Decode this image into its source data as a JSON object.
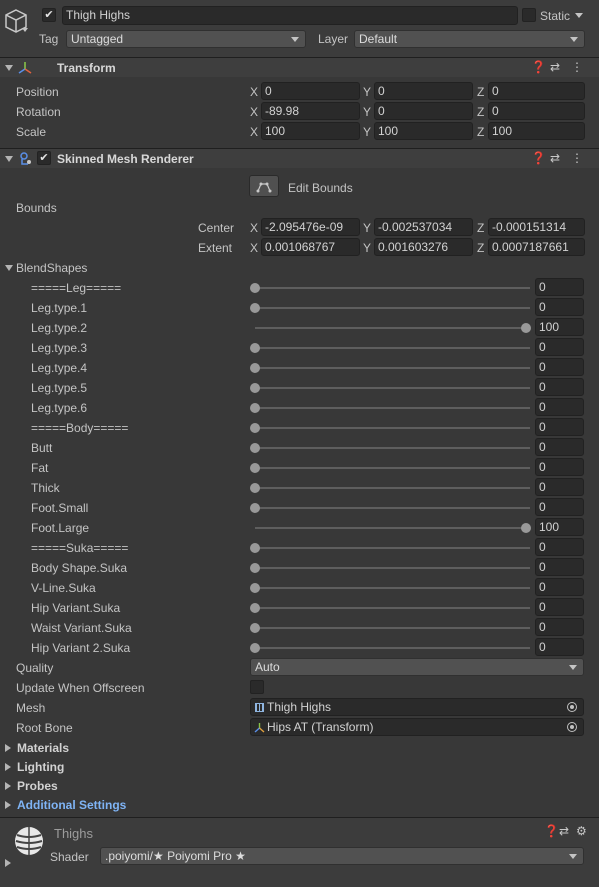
{
  "gameobject": {
    "name": "Thigh Highs",
    "active": true,
    "static_label": "Static",
    "tag_label": "Tag",
    "tag_value": "Untagged",
    "layer_label": "Layer",
    "layer_value": "Default"
  },
  "transform": {
    "title": "Transform",
    "rows": [
      {
        "label": "Position",
        "x": "0",
        "y": "0",
        "z": "0"
      },
      {
        "label": "Rotation",
        "x": "-89.98",
        "y": "0",
        "z": "0"
      },
      {
        "label": "Scale",
        "x": "100",
        "y": "100",
        "z": "100"
      }
    ]
  },
  "axes": {
    "x": "X",
    "y": "Y",
    "z": "Z"
  },
  "smr": {
    "title": "Skinned Mesh Renderer",
    "enabled": true,
    "edit_bounds": "Edit Bounds",
    "bounds_label": "Bounds",
    "center_label": "Center",
    "center": {
      "x": "-2.095476e-09",
      "y": "-0.002537034",
      "z": "-0.000151314"
    },
    "extent_label": "Extent",
    "extent": {
      "x": "0.001068767",
      "y": "0.001603276",
      "z": "0.0007187661"
    },
    "blendshapes_label": "BlendShapes",
    "blendshapes": [
      {
        "name": "=====Leg=====",
        "value": "0",
        "fraction": 0
      },
      {
        "name": "Leg.type.1",
        "value": "0",
        "fraction": 0
      },
      {
        "name": "Leg.type.2",
        "value": "100",
        "fraction": 1
      },
      {
        "name": "Leg.type.3",
        "value": "0",
        "fraction": 0
      },
      {
        "name": "Leg.type.4",
        "value": "0",
        "fraction": 0
      },
      {
        "name": "Leg.type.5",
        "value": "0",
        "fraction": 0
      },
      {
        "name": "Leg.type.6",
        "value": "0",
        "fraction": 0
      },
      {
        "name": "=====Body=====",
        "value": "0",
        "fraction": 0
      },
      {
        "name": "Butt",
        "value": "0",
        "fraction": 0
      },
      {
        "name": "Fat",
        "value": "0",
        "fraction": 0
      },
      {
        "name": "Thick",
        "value": "0",
        "fraction": 0
      },
      {
        "name": "Foot.Small",
        "value": "0",
        "fraction": 0
      },
      {
        "name": "Foot.Large",
        "value": "100",
        "fraction": 1
      },
      {
        "name": "=====Suka=====",
        "value": "0",
        "fraction": 0
      },
      {
        "name": "Body Shape.Suka",
        "value": "0",
        "fraction": 0
      },
      {
        "name": "V-Line.Suka",
        "value": "0",
        "fraction": 0
      },
      {
        "name": "Hip Variant.Suka",
        "value": "0",
        "fraction": 0
      },
      {
        "name": "Waist Variant.Suka",
        "value": "0",
        "fraction": 0
      },
      {
        "name": "Hip Variant 2.Suka",
        "value": "0",
        "fraction": 0
      }
    ],
    "quality_label": "Quality",
    "quality_value": "Auto",
    "offscreen_label": "Update When Offscreen",
    "offscreen_checked": false,
    "mesh_label": "Mesh",
    "mesh_value": "Thigh Highs",
    "rootbone_label": "Root Bone",
    "rootbone_value": "Hips AT (Transform)",
    "foldouts": [
      "Materials",
      "Lighting",
      "Probes",
      "Additional Settings"
    ]
  },
  "material": {
    "name": "Thighs",
    "shader_label": "Shader",
    "shader_value": ".poiyomi/★ Poiyomi Pro ★"
  },
  "colors": {
    "background": "#383838",
    "header": "#3e3e3e",
    "field": "#2a2a2a",
    "link_blue": "#7fb4f5"
  }
}
